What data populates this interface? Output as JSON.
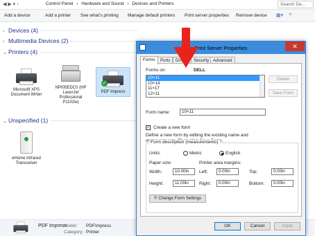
{
  "address_bar": {
    "crumbs": [
      "Control Panel",
      "›",
      "Hardware and Sound",
      "›",
      "Devices and Printers"
    ],
    "search_placeholder": "Search De..."
  },
  "command_bar": {
    "add_device": "Add a device",
    "add_printer": "Add a printer",
    "whats_printing": "See what's printing",
    "manage_default": "Manage default printers",
    "print_server": "Print server properties",
    "remove_device": "Remove device"
  },
  "groups": {
    "devices": "Devices (4)",
    "multimedia": "Multimedia Devices (2)",
    "printers": "Printers (4)",
    "unspecified": "Unspecified (1)"
  },
  "printers": [
    {
      "name": "Microsoft XPS Document Writer"
    },
    {
      "name": "NPI05EDC0 (HP LaserJet Professional P1102w)"
    },
    {
      "name": "PDF Impress"
    }
  ],
  "unspecified_devices": [
    {
      "name": "eHome Infrared Transceiver"
    }
  ],
  "details_pane": {
    "name": "PDF Impress",
    "model_label": "Model:",
    "model_value": "PDFImpress",
    "category_label": "Category:",
    "category_value": "Printer"
  },
  "dialog": {
    "title": "Print Server Properties",
    "tabs": [
      "Forms",
      "Ports",
      "Drivers",
      "Security",
      "Advanced"
    ],
    "forms_on_label": "Forms on:",
    "forms_on_value": "DELL",
    "forms_list": [
      "10×11",
      "10×14",
      "11×17",
      "12×11"
    ],
    "delete_label": "Delete",
    "save_form_label": "Save Form",
    "form_name_label": "Form name:",
    "form_name_value": "10×11",
    "create_new_label": "Create a new form",
    "create_new_checked": true,
    "help_text": "Define a new form by editing the existing name and measurements. Then click Save Form.",
    "description_legend": "Form description (measurements)",
    "units_label": "Units:",
    "metric_label": "Metric",
    "english_label": "English",
    "paper_size_label": "Paper size:",
    "margins_label": "Printer area margins:",
    "width_label": "Width:",
    "width_value": "10.00in",
    "height_label": "Height:",
    "height_value": "11.00in",
    "left_label": "Left:",
    "left_value": "0.00in",
    "right_label": "Right:",
    "right_value": "0.00in",
    "top_label": "Top:",
    "top_value": "0.00in",
    "bottom_label": "Bottom:",
    "bottom_value": "0.00in",
    "change_settings_label": "Change Form Settings",
    "ok_label": "OK",
    "cancel_label": "Cancel",
    "apply_label": "Apply"
  },
  "colors": {
    "accent": "#3c8cdd",
    "annotation_arrow": "#e8231d",
    "group_heading": "#1e3287"
  }
}
